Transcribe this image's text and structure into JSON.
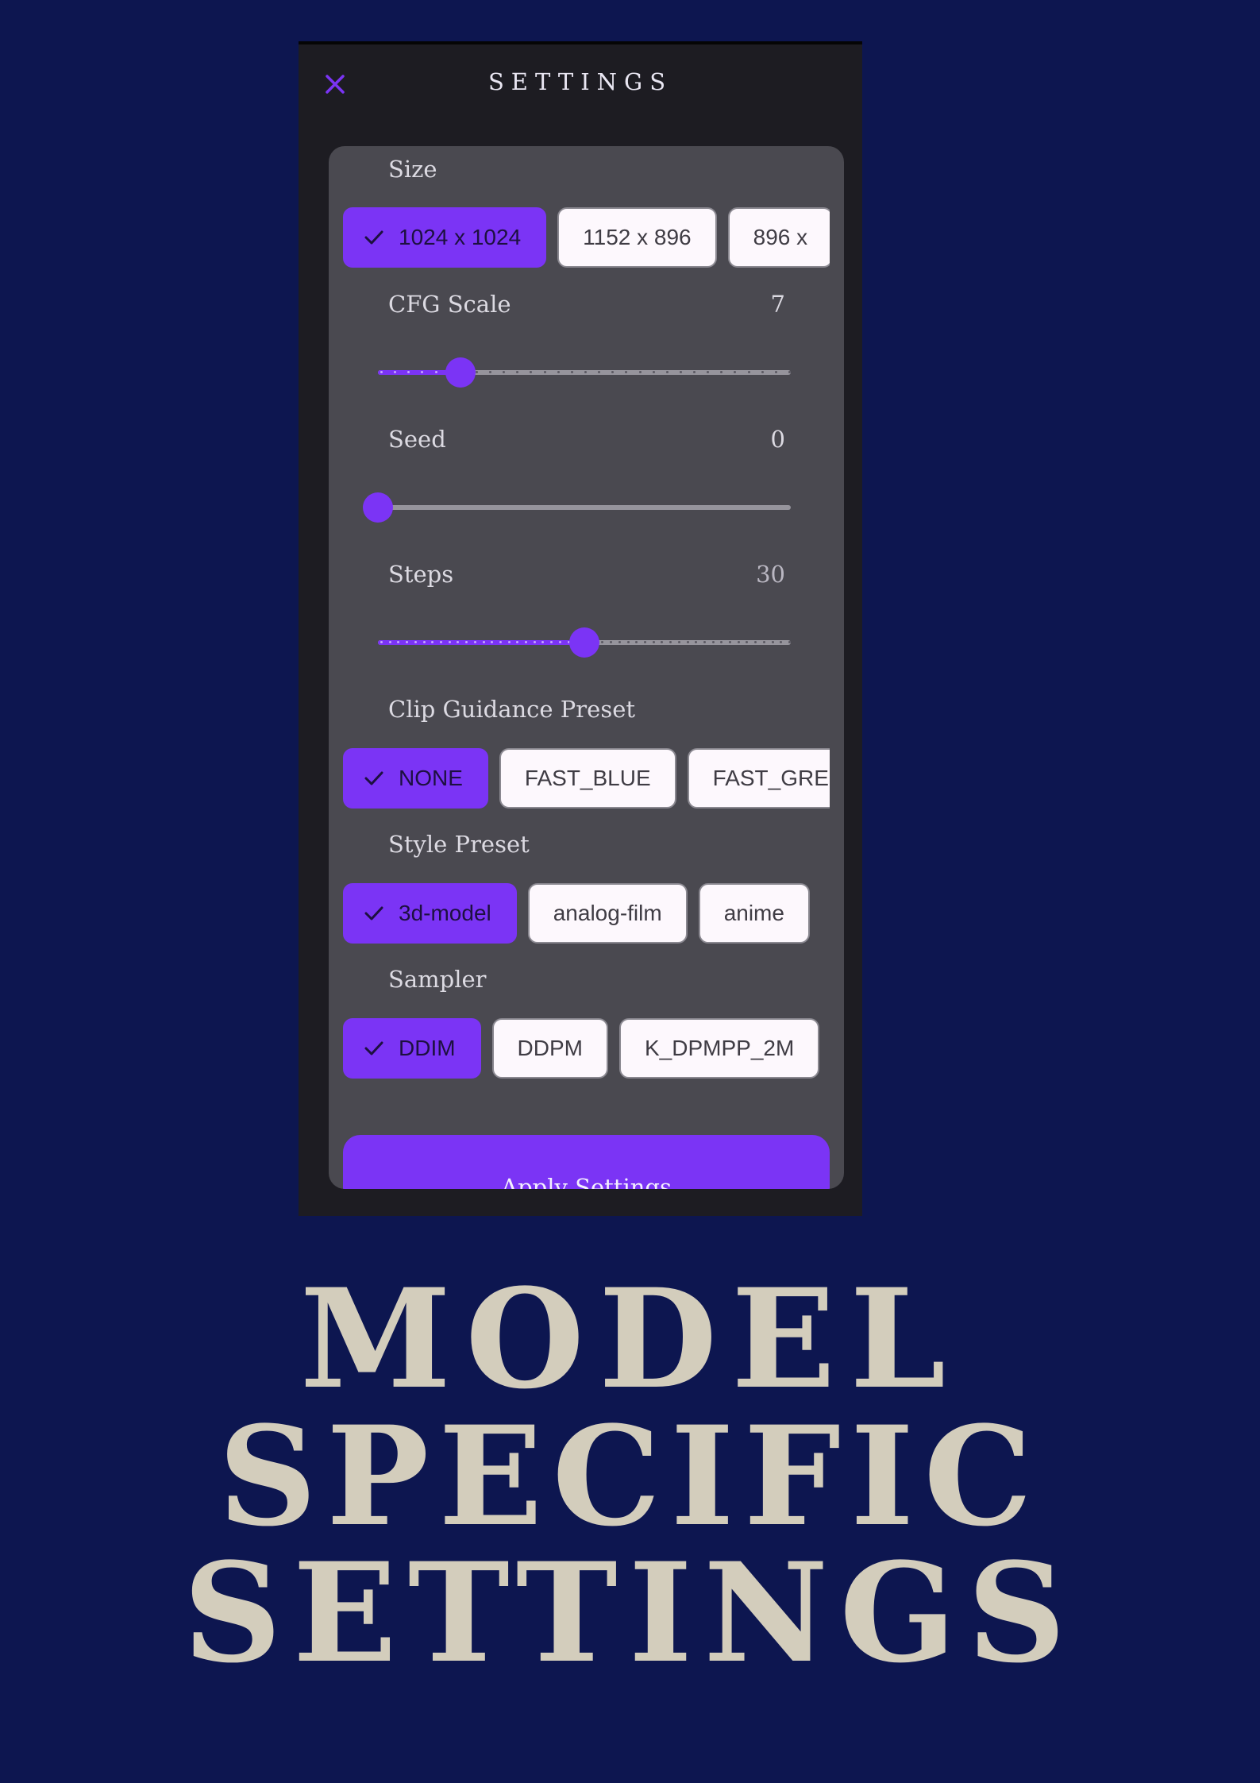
{
  "header": {
    "title": "SETTINGS",
    "close_icon": "close-icon"
  },
  "accent_color": "#7b34f5",
  "sections": {
    "size": {
      "label": "Size",
      "options": [
        "1024 x 1024",
        "1152 x 896",
        "896 x"
      ],
      "selected_index": 0
    },
    "cfg_scale": {
      "label": "CFG Scale",
      "value": "7",
      "level": 0.2
    },
    "seed": {
      "label": "Seed",
      "value": "0",
      "level": 0.0
    },
    "steps": {
      "label": "Steps",
      "value": "30",
      "level": 0.5
    },
    "clip_guidance": {
      "label": "Clip Guidance Preset",
      "options": [
        "NONE",
        "FAST_BLUE",
        "FAST_GREE"
      ],
      "selected_index": 0
    },
    "style_preset": {
      "label": "Style Preset",
      "options": [
        "3d-model",
        "analog-film",
        "anime"
      ],
      "selected_index": 0
    },
    "sampler": {
      "label": "Sampler",
      "options": [
        "DDIM",
        "DDPM",
        "K_DPMPP_2M"
      ],
      "selected_index": 0
    }
  },
  "apply_label": "Apply Settings",
  "headline": {
    "line1": "MODEL",
    "line2": "SPECIFIC",
    "line3": "SETTINGS"
  }
}
